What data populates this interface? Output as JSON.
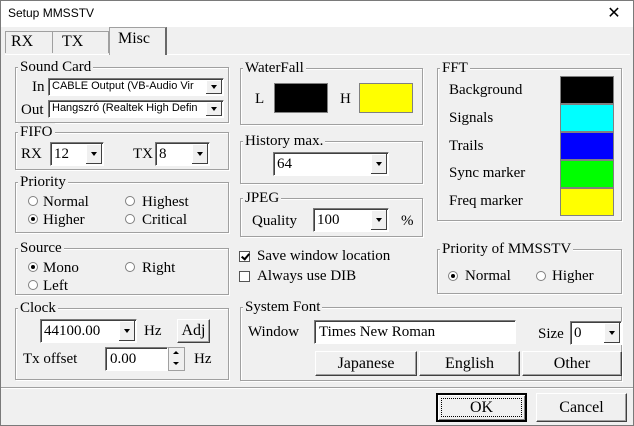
{
  "window": {
    "title": "Setup MMSSTV",
    "close_glyph": "✕"
  },
  "tabs": [
    "RX",
    "TX",
    "Misc"
  ],
  "sound_card": {
    "label": "Sound Card",
    "in_label": "In",
    "in_value": "CABLE Output (VB-Audio Vir",
    "out_label": "Out",
    "out_value": "Hangszró (Realtek High Defin"
  },
  "fifo": {
    "label": "FIFO",
    "rx_label": "RX",
    "rx_value": "12",
    "tx_label": "TX",
    "tx_value": "8"
  },
  "priority": {
    "label": "Priority",
    "options": [
      "Normal",
      "Highest",
      "Higher",
      "Critical"
    ],
    "selected": "Higher"
  },
  "source": {
    "label": "Source",
    "options": [
      "Mono",
      "Right",
      "Left"
    ],
    "selected": "Mono"
  },
  "clock": {
    "label": "Clock",
    "value": "44100.00",
    "hz": "Hz",
    "adj_label": "Adj",
    "tx_offset_label": "Tx offset",
    "tx_offset_value": "0.00",
    "tx_offset_unit": "Hz"
  },
  "waterfall": {
    "label": "WaterFall",
    "l_label": "L",
    "h_label": "H",
    "l_color": "#000000",
    "h_color": "#ffff00"
  },
  "history": {
    "label": "History max.",
    "value": "64"
  },
  "jpeg": {
    "label": "JPEG",
    "quality_label": "Quality",
    "quality_value": "100",
    "unit": "%"
  },
  "fft": {
    "label": "FFT",
    "items": [
      {
        "label": "Background",
        "color": "#000000"
      },
      {
        "label": "Signals",
        "color": "#00ffff"
      },
      {
        "label": "Trails",
        "color": "#0000ff"
      },
      {
        "label": "Sync marker",
        "color": "#00ff00"
      },
      {
        "label": "Freq marker",
        "color": "#ffff00"
      }
    ]
  },
  "save_window_location": {
    "label": "Save window location",
    "checked": true
  },
  "always_use_dib": {
    "label": "Always use DIB",
    "checked": false
  },
  "priority_mmsstv": {
    "label": "Priority of MMSSTV",
    "options": [
      "Normal",
      "Higher"
    ],
    "selected": "Normal"
  },
  "system_font": {
    "label": "System Font",
    "window_label": "Window",
    "window_value": "Times New Roman",
    "size_label": "Size",
    "size_value": "0",
    "buttons": [
      "Japanese",
      "English",
      "Other"
    ]
  },
  "dialog": {
    "ok_label": "OK",
    "cancel_label": "Cancel"
  }
}
